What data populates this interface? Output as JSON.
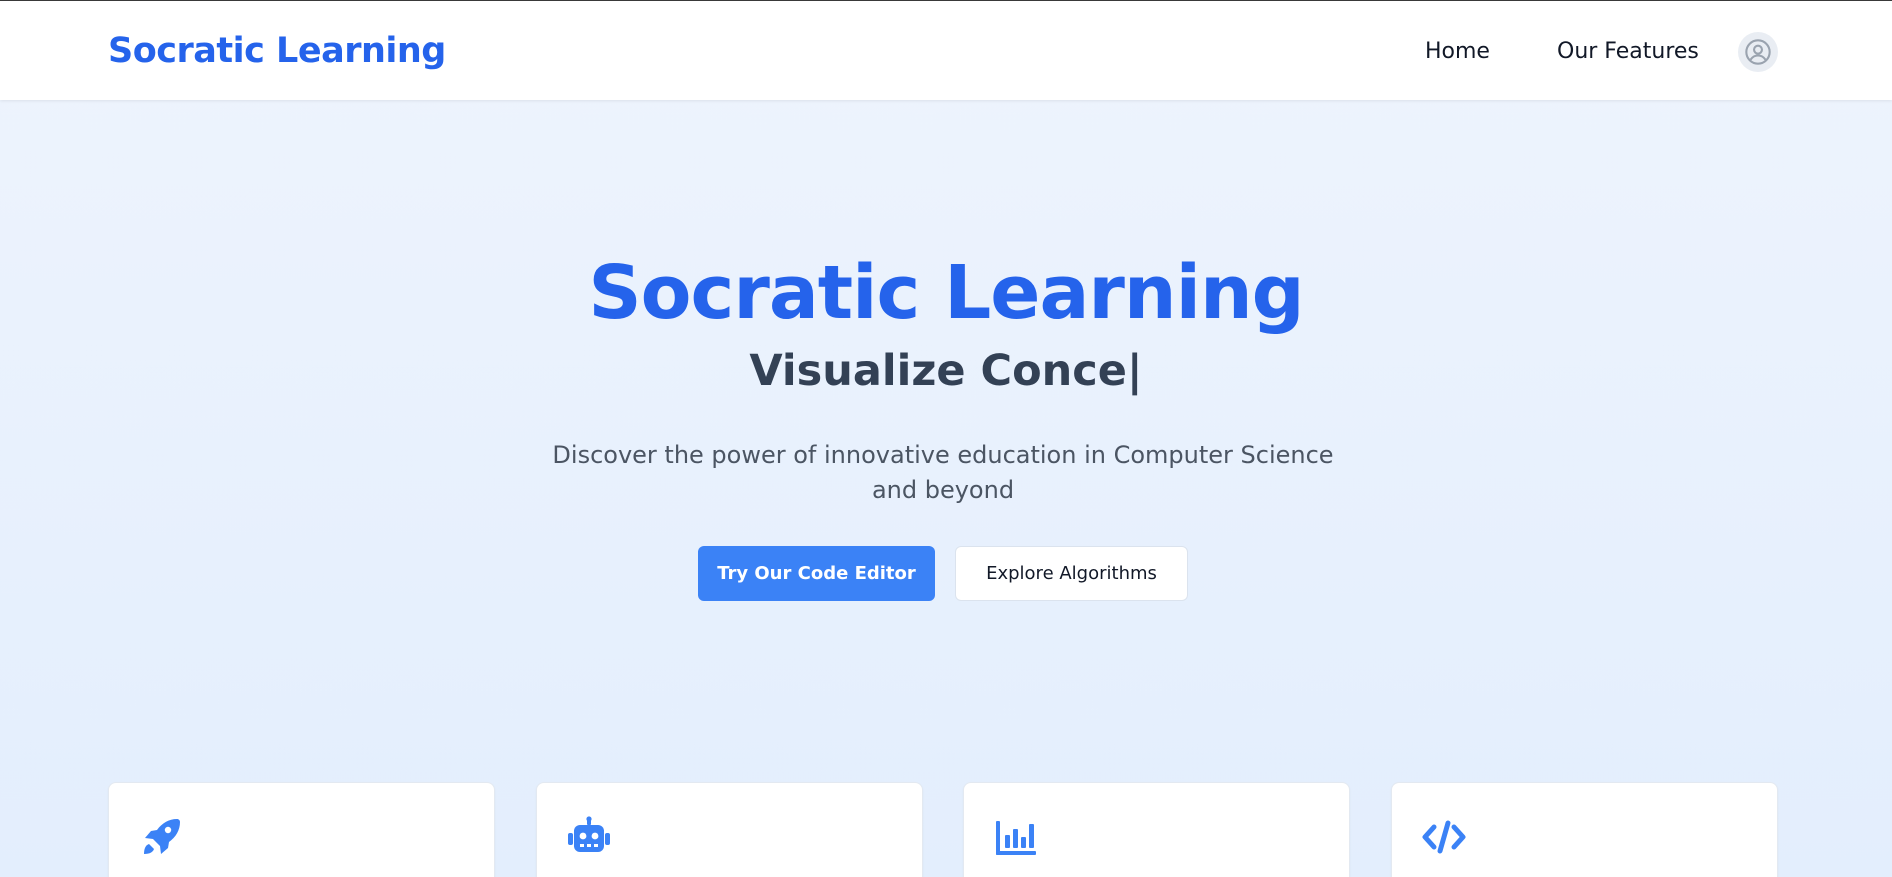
{
  "navbar": {
    "brand": "Socratic Learning",
    "links": [
      {
        "label": "Home"
      },
      {
        "label": "Our Features"
      }
    ],
    "avatar_icon": "user-circle-icon"
  },
  "hero": {
    "title": "Socratic Learning",
    "typing_text": "Visualize Conce|",
    "description": "Discover the power of innovative education in Computer Science and beyond",
    "primary_button": "Try Our Code Editor",
    "secondary_button": "Explore Algorithms"
  },
  "features": {
    "cards": [
      {
        "icon": "rocket-icon"
      },
      {
        "icon": "robot-icon"
      },
      {
        "icon": "bar-chart-icon"
      },
      {
        "icon": "code-icon"
      }
    ]
  },
  "colors": {
    "brand": "#2563eb",
    "primary_button": "#3b82f6",
    "subtitle": "#334155",
    "background": "#e9f1fd"
  }
}
